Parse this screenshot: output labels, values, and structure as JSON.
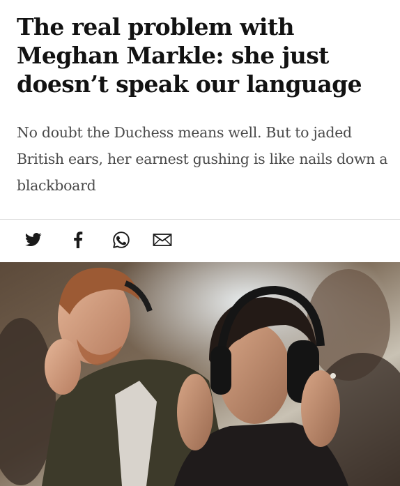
{
  "article": {
    "headline": "The real problem with Meghan Markle: she just doesn’t speak our language",
    "standfirst": "No doubt the Duchess means well. But to jaded British ears, her earnest gushing is like nails down a blackboard"
  },
  "share": {
    "icons": [
      "twitter-icon",
      "facebook-icon",
      "whatsapp-icon",
      "email-icon"
    ]
  },
  "photo": {
    "subject": "man-and-woman-wearing-headphones"
  },
  "colors": {
    "headline": "#121212",
    "standfirst": "#4a4a4a",
    "divider": "#d9d9d9",
    "icon": "#1a1a1a"
  }
}
